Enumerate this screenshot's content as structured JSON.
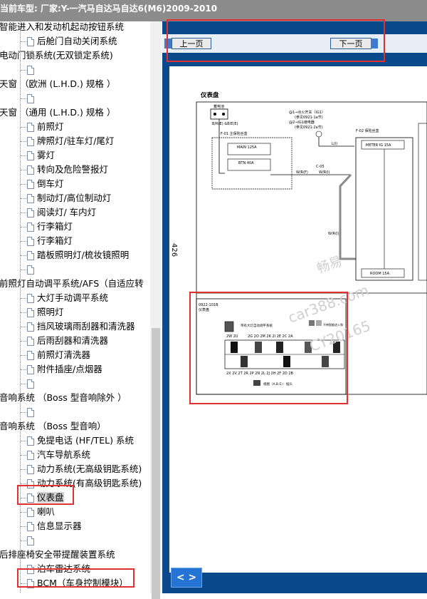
{
  "title_bar": "当前车型:  厂家:Y-一汽马自达马自达6(M6)2009-2010",
  "tree_items": [
    {
      "label": "智能进入和发动机起动按钮系统",
      "indent": 0
    },
    {
      "label": "后舱门自动关闭系统",
      "indent": 1
    },
    {
      "label": "电动门锁系统(无双锁定系统)",
      "indent": 0
    },
    {
      "label": "",
      "indent": 1
    },
    {
      "label": "天窗    （欧洲 (L.H.D.) 规格 ）",
      "indent": 0
    },
    {
      "label": "",
      "indent": 1
    },
    {
      "label": "天窗    （通用 (L.H.D.) 规格 ）",
      "indent": 0
    },
    {
      "label": "前照灯",
      "indent": 1
    },
    {
      "label": "牌照灯/驻车灯/尾灯",
      "indent": 1
    },
    {
      "label": "雾灯",
      "indent": 1
    },
    {
      "label": "转向及危险警报灯",
      "indent": 1
    },
    {
      "label": "倒车灯",
      "indent": 1
    },
    {
      "label": "制动灯/高位制动灯",
      "indent": 1
    },
    {
      "label": "阅读灯/ 车内灯",
      "indent": 1
    },
    {
      "label": "行李箱灯",
      "indent": 1
    },
    {
      "label": "行李箱灯",
      "indent": 1
    },
    {
      "label": "踏板照明灯/梳妆镜照明",
      "indent": 1
    },
    {
      "label": "",
      "indent": 1
    },
    {
      "label": "前照灯自动调平系统/AFS（自适应转",
      "indent": 0
    },
    {
      "label": "大灯手动调平系统",
      "indent": 1
    },
    {
      "label": "照明灯",
      "indent": 1
    },
    {
      "label": "挡风玻璃雨刮器和清洗器",
      "indent": 1
    },
    {
      "label": "后雨刮器和清洗器",
      "indent": 1
    },
    {
      "label": "前照灯清洗器",
      "indent": 1
    },
    {
      "label": "附件插座/点烟器",
      "indent": 1
    },
    {
      "label": "",
      "indent": 1
    },
    {
      "label": "音响系统    （Boss 型音响除外 ）",
      "indent": 0
    },
    {
      "label": "",
      "indent": 1
    },
    {
      "label": "音响系统    （Boss 型音响）",
      "indent": 0
    },
    {
      "label": "免提电话 (HF/TEL) 系统",
      "indent": 1
    },
    {
      "label": "汽车导航系统",
      "indent": 1
    },
    {
      "label": "动力系统(无高级钥匙系统)",
      "indent": 1
    },
    {
      "label": "动力系统(有高级钥匙系统)",
      "indent": 1
    },
    {
      "label": "仪表盘",
      "indent": 1,
      "selected": true
    },
    {
      "label": "喇叭",
      "indent": 1
    },
    {
      "label": "信息显示器",
      "indent": 1
    },
    {
      "label": "",
      "indent": 1
    },
    {
      "label": "后排座椅安全带提醒装置系统",
      "indent": 0
    },
    {
      "label": "泊车雷达系统",
      "indent": 1
    },
    {
      "label": "BCM（车身控制模块）",
      "indent": 1
    }
  ],
  "viewer": {
    "prev_label": "上一页",
    "next_label": "下一页",
    "nav_label": "< >"
  },
  "diagram": {
    "page_number": "426",
    "title": "仪表盘",
    "battery": "蓄电池",
    "battery_wire": "B/R(E)\n&B/E(E)",
    "fuse_box_1": "F-01 主保险丝盒",
    "main_fuse": "MAIN 125A",
    "btn_fuse": "BTN 40A",
    "ign_note_1": "@1→点火开关（IG1）",
    "ign_note_1b": "(参见0921-1a节)",
    "ign_note_2": "@2→IG1继电器",
    "ign_note_2b": "(参见0921-2a节)",
    "fuse_box_2": "F-02 保险丝盒",
    "meter_fuse": "METER IG 15A",
    "room_fuse": "ROOM 15A",
    "wire_l": "L(I)",
    "wire_wr_f": "W/R(F)",
    "wire_wr_i": "W/R(I)",
    "wire_wr_i2": "W/R(I)",
    "joint": "C-05",
    "connector_code": "0922-101B",
    "connector_name": "仪表盘",
    "connector_note_a": "带有大灯自动调平系统",
    "connector_note_b": "不带智能进入和",
    "connector_note_c": "视图（A.B.E）：插头",
    "terminals_top": [
      "2G",
      "2O",
      "2M",
      "2K",
      "2I",
      "2E",
      "2C",
      "2A"
    ],
    "terminals_top2": [
      "2W",
      "2U",
      "2S",
      "2Q"
    ],
    "terminals_bottom": [
      "2X",
      "2V",
      "2T",
      "2R",
      "2P",
      "2N",
      "2L",
      "2J",
      "2H",
      "2F",
      "2D",
      "2B"
    ],
    "watermark_1": "畅易",
    "watermark_2": "car388.com",
    "watermark_3": "CY20165"
  }
}
